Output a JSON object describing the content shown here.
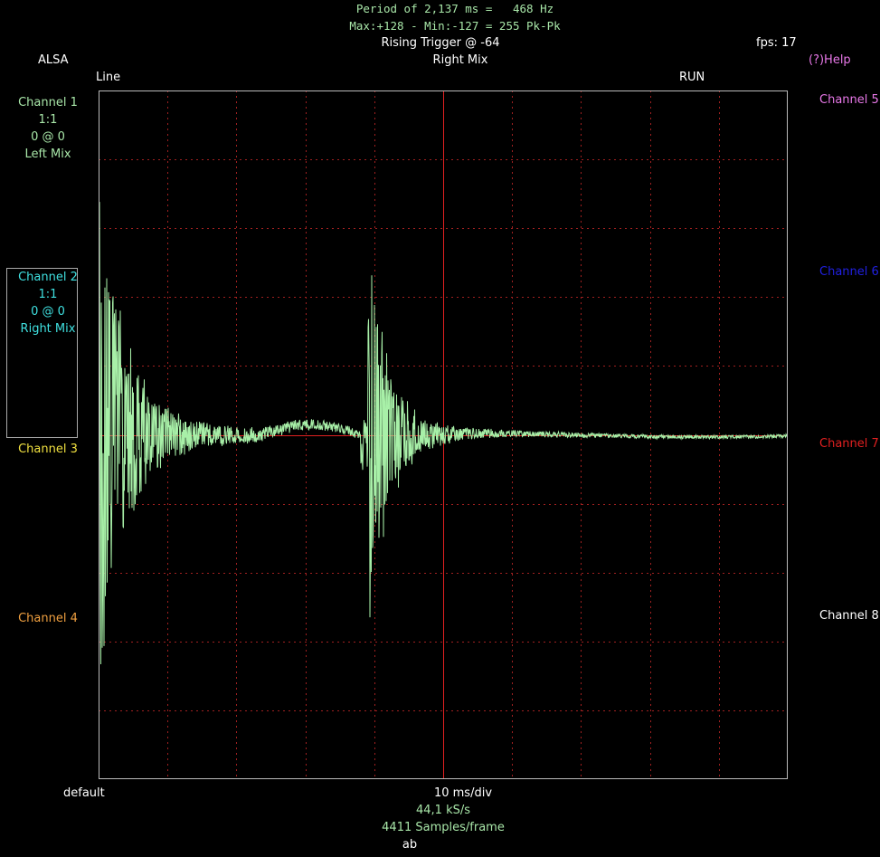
{
  "header": {
    "period_line": "Period of 2,137 ms =   468 Hz",
    "minmax_line": "Max:+128 - Min:-127 = 255 Pk-Pk",
    "trigger": "Rising Trigger @ -64",
    "fps": "fps: 17",
    "source": "ALSA",
    "help": "(?)Help",
    "trigger_channel": "Right Mix",
    "input_line": "Line",
    "run_state": "RUN"
  },
  "channels_left": [
    {
      "name": "Channel 1",
      "lines": [
        "1:1",
        "0 @ 0",
        "Left Mix"
      ],
      "color": "#a8e6a8"
    },
    {
      "name": "Channel 2",
      "lines": [
        "1:1",
        "0 @ 0",
        "Right Mix"
      ],
      "color": "#3fe0e0"
    },
    {
      "name": "Channel 3",
      "lines": [],
      "color": "#f0e040"
    },
    {
      "name": "Channel 4",
      "lines": [],
      "color": "#f0a040"
    }
  ],
  "channels_right": [
    {
      "name": "Channel 5",
      "color": "#e878e8"
    },
    {
      "name": "Channel 6",
      "color": "#2020e0"
    },
    {
      "name": "Channel 7",
      "color": "#e02020"
    },
    {
      "name": "Channel 8",
      "color": "#ffffff"
    }
  ],
  "footer": {
    "default_label": "default",
    "timebase": "10 ms/div",
    "sample_rate": "44,1 kS/s",
    "samples_frame": "4411 Samples/frame",
    "mode": "ab"
  },
  "colors": {
    "trace": "#a8f0a8",
    "grid": "#a02020",
    "trigger_line": "#e02020",
    "frame": "#bbbbbb"
  }
}
